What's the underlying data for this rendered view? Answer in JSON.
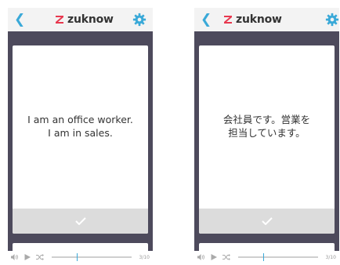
{
  "app": {
    "brand": "zuknow",
    "accent_color": "#3aa9d8",
    "logo_color": "#e8384f",
    "frame_color": "#4d4a5c"
  },
  "screens": [
    {
      "card_text": "I am an office worker.\nI am in sales.",
      "counter": "3/10",
      "progress": 0.32,
      "icons": [
        "back-chevron",
        "gear",
        "check",
        "volume",
        "play",
        "shuffle"
      ]
    },
    {
      "card_text": "会社員です。営業を\n担当しています。",
      "counter": "3/10",
      "progress": 0.32,
      "icons": [
        "back-chevron",
        "gear",
        "check",
        "volume",
        "play",
        "shuffle"
      ]
    }
  ]
}
